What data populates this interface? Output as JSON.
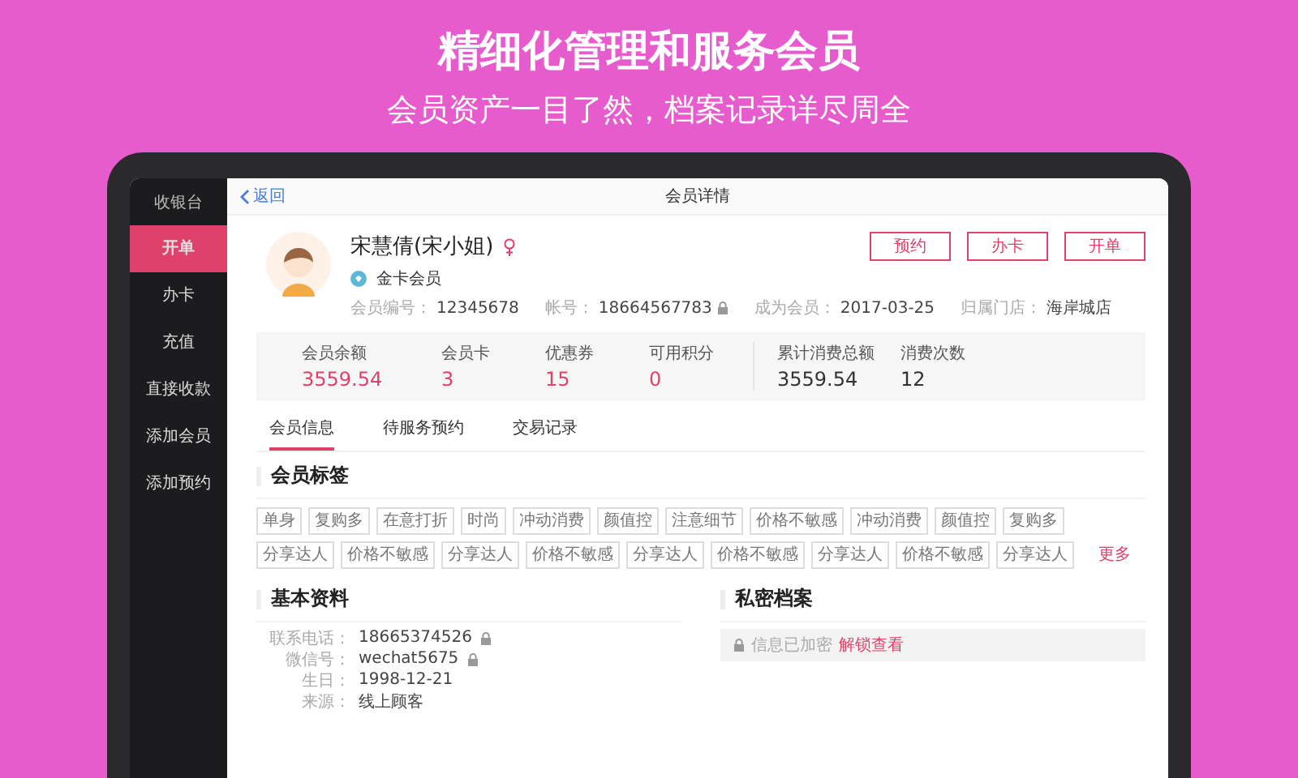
{
  "promo": {
    "headline": "精细化管理和服务会员",
    "subheadline": "会员资产一目了然，档案记录详尽周全"
  },
  "sidebar": {
    "title": "收银台",
    "items": [
      {
        "label": "开单",
        "selected": true
      },
      {
        "label": "办卡",
        "selected": false
      },
      {
        "label": "充值",
        "selected": false
      },
      {
        "label": "直接收款",
        "selected": false
      },
      {
        "label": "添加会员",
        "selected": false
      },
      {
        "label": "添加预约",
        "selected": false
      }
    ]
  },
  "header": {
    "back": "返回",
    "title": "会员详情"
  },
  "member": {
    "name": "宋慧倩(宋小姐)",
    "level": "金卡会员",
    "fields": [
      {
        "label": "会员编号：",
        "value": "12345678",
        "locked": false
      },
      {
        "label": "帐号：",
        "value": "18664567783",
        "locked": true
      },
      {
        "label": "成为会员：",
        "value": "2017-03-25",
        "locked": false
      },
      {
        "label": "归属门店：",
        "value": "海岸城店",
        "locked": false
      }
    ]
  },
  "actions": [
    "预约",
    "办卡",
    "开单"
  ],
  "stats": [
    {
      "label": "会员余额",
      "value": "3559.54",
      "kind": "asset"
    },
    {
      "label": "会员卡",
      "value": "3",
      "kind": "asset"
    },
    {
      "label": "优惠券",
      "value": "15",
      "kind": "asset"
    },
    {
      "label": "可用积分",
      "value": "0",
      "kind": "asset"
    },
    {
      "label": "累计消费总额",
      "value": "3559.54",
      "kind": "consumption"
    },
    {
      "label": "消费次数",
      "value": "12",
      "kind": "consumption"
    }
  ],
  "tabs": [
    {
      "label": "会员信息",
      "selected": true
    },
    {
      "label": "待服务预约",
      "selected": false
    },
    {
      "label": "交易记录",
      "selected": false
    }
  ],
  "tags_section": {
    "title": "会员标签",
    "tags": [
      "单身",
      "复购多",
      "在意打折",
      "时尚",
      "冲动消费",
      "颜值控",
      "注意细节",
      "价格不敏感",
      "冲动消费",
      "颜值控",
      "复购多",
      "分享达人",
      "价格不敏感",
      "分享达人",
      "价格不敏感",
      "分享达人",
      "价格不敏感",
      "分享达人",
      "价格不敏感",
      "分享达人"
    ],
    "more": "更多"
  },
  "basic": {
    "title": "基本资料",
    "fields": [
      {
        "label": "联系电话：",
        "value": "18665374526",
        "locked": true
      },
      {
        "label": "微信号：",
        "value": "wechat5675",
        "locked": true
      },
      {
        "label": "生日：",
        "value": "1998-12-21",
        "locked": false
      },
      {
        "label": "来源：",
        "value": "线上顾客",
        "locked": false
      }
    ]
  },
  "private": {
    "title": "私密档案",
    "notice": "信息已加密",
    "link": "解锁查看"
  }
}
